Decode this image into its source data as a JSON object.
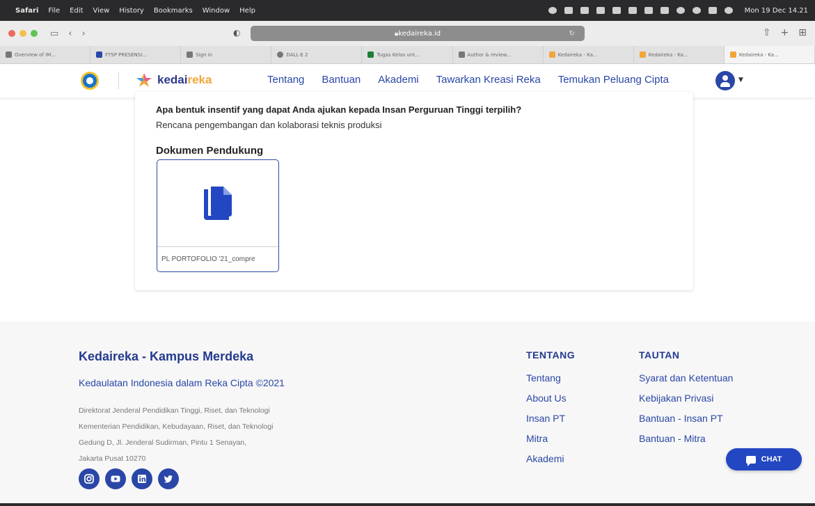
{
  "menubar": {
    "app": "Safari",
    "items": [
      "File",
      "Edit",
      "View",
      "History",
      "Bookmarks",
      "Window",
      "Help"
    ],
    "clock": "Mon 19 Dec 14.21"
  },
  "browser": {
    "url": "kedaireka.id",
    "tabs": [
      {
        "label": "Overview of IM..."
      },
      {
        "label": "FTSP PRESENSI..."
      },
      {
        "label": "Sign in"
      },
      {
        "label": "DALL·E 2"
      },
      {
        "label": "Tugas Kelas unt..."
      },
      {
        "label": "Author & review..."
      },
      {
        "label": "Kedaireka - Ka..."
      },
      {
        "label": "Kedaireka - Ka..."
      },
      {
        "label": "Kedaireka - Ka..."
      }
    ]
  },
  "site": {
    "logo_main": "kedai",
    "logo_accent": "reka",
    "nav": [
      "Tentang",
      "Bantuan",
      "Akademi",
      "Tawarkan Kreasi Reka",
      "Temukan Peluang Cipta"
    ]
  },
  "content": {
    "question": "Apa bentuk insentif yang dapat Anda ajukan kepada Insan Perguruan Tinggi terpilih?",
    "answer": "Rencana pengembangan dan kolaborasi teknis produksi",
    "docs_title": "Dokumen Pendukung",
    "doc_filename": "PL PORTOFOLIO '21_compre"
  },
  "footer": {
    "title": "Kedaireka - Kampus Merdeka",
    "tagline": "Kedaulatan Indonesia dalam Reka Cipta ©2021",
    "address": [
      "Direktorat Jenderal Pendidikan Tinggi, Riset, dan Teknologi",
      "Kementerian Pendidikan, Kebudayaan, Riset, dan Teknologi",
      "Gedung D, Jl. Jenderal Sudirman, Pintu 1 Senayan,",
      "Jakarta Pusat 10270"
    ],
    "tentang": {
      "heading": "TENTANG",
      "links": [
        "Tentang",
        "About Us",
        "Insan PT",
        "Mitra",
        "Akademi"
      ]
    },
    "tautan": {
      "heading": "TAUTAN",
      "links": [
        "Syarat dan Ketentuan",
        "Kebijakan Privasi",
        "Bantuan - Insan PT",
        "Bantuan - Mitra"
      ]
    },
    "socials": [
      "instagram-icon",
      "youtube-icon",
      "linkedin-icon",
      "twitter-icon"
    ]
  },
  "chat": {
    "label": "CHAT"
  },
  "colors": {
    "primary": "#2a46a6",
    "accent": "#f2a53a",
    "chat": "#2346c2"
  }
}
